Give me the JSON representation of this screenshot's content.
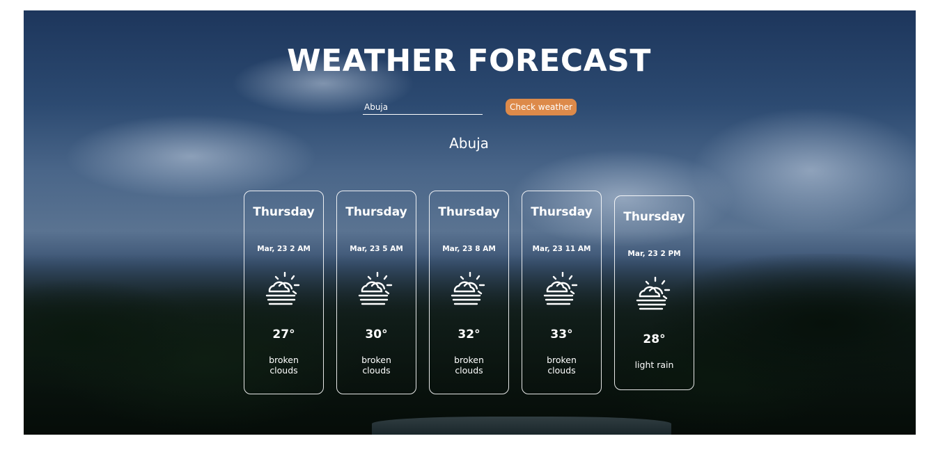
{
  "header": {
    "title": "WEATHER FORECAST"
  },
  "search": {
    "value": "Abuja",
    "button_label": "Check weather"
  },
  "location": {
    "city": "Abuja"
  },
  "forecast": [
    {
      "day": "Thursday",
      "datetime": "Mar, 23 2 AM",
      "icon": "partly-cloudy-icon",
      "temp": "27°",
      "desc": "broken clouds"
    },
    {
      "day": "Thursday",
      "datetime": "Mar, 23 5 AM",
      "icon": "partly-cloudy-icon",
      "temp": "30°",
      "desc": "broken clouds"
    },
    {
      "day": "Thursday",
      "datetime": "Mar, 23 8 AM",
      "icon": "partly-cloudy-icon",
      "temp": "32°",
      "desc": "broken clouds"
    },
    {
      "day": "Thursday",
      "datetime": "Mar, 23 11 AM",
      "icon": "partly-cloudy-icon",
      "temp": "33°",
      "desc": "broken clouds"
    },
    {
      "day": "Thursday",
      "datetime": "Mar, 23 2 PM",
      "icon": "partly-cloudy-icon",
      "temp": "28°",
      "desc": "light rain"
    }
  ],
  "colors": {
    "button": "#dd8a4a",
    "text": "#ffffff"
  }
}
